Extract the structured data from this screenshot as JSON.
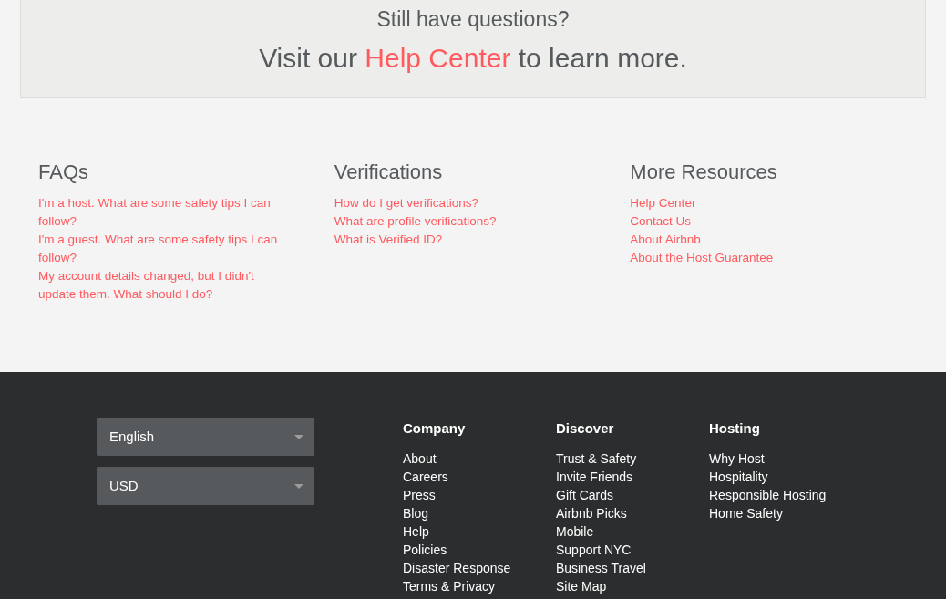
{
  "help_banner": {
    "question": "Still have questions?",
    "prefix": "Visit our ",
    "link": "Help Center",
    "suffix": " to learn more."
  },
  "help_columns": [
    {
      "title": "FAQs",
      "links": [
        "I'm a host. What are some safety tips I can follow?",
        "I'm a guest. What are some safety tips I can follow?",
        "My account details changed, but I didn't update them. What should I do?"
      ]
    },
    {
      "title": "Verifications",
      "links": [
        "How do I get verifications?",
        "What are profile verifications?",
        "What is Verified ID?"
      ]
    },
    {
      "title": "More Resources",
      "links": [
        "Help Center",
        "Contact Us",
        "About Airbnb",
        "About the Host Guarantee"
      ]
    }
  ],
  "footer": {
    "selects": [
      {
        "value": "English"
      },
      {
        "value": "USD"
      }
    ],
    "columns": [
      {
        "title": "Company",
        "links": [
          "About",
          "Careers",
          "Press",
          "Blog",
          "Help",
          "Policies",
          "Disaster Response",
          "Terms & Privacy"
        ]
      },
      {
        "title": "Discover",
        "links": [
          "Trust & Safety",
          "Invite Friends",
          "Gift Cards",
          "Airbnb Picks",
          "Mobile",
          "Support NYC",
          "Business Travel",
          "Site Map"
        ]
      },
      {
        "title": "Hosting",
        "links": [
          "Why Host",
          "Hospitality",
          "Responsible Hosting",
          "Home Safety"
        ]
      }
    ]
  }
}
